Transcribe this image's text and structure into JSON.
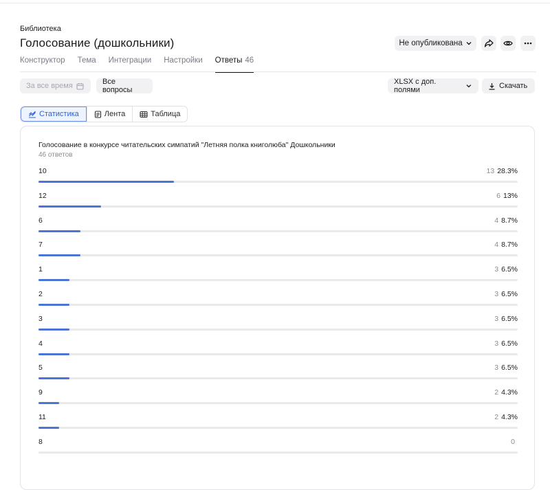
{
  "header": {
    "breadcrumb": "Библиотека",
    "title": "Голосование (дошкольники)",
    "status_label": "Не опубликована"
  },
  "tabs": [
    {
      "label": "Конструктор",
      "count": ""
    },
    {
      "label": "Тема",
      "count": ""
    },
    {
      "label": "Интеграции",
      "count": ""
    },
    {
      "label": "Настройки",
      "count": ""
    },
    {
      "label": "Ответы",
      "count": "46",
      "active": true
    }
  ],
  "filters": {
    "period_placeholder": "За все время",
    "questions_label": "Все вопросы",
    "export_label": "XLSX с доп. полями",
    "download_label": "Скачать"
  },
  "views": {
    "stats": "Статистика",
    "feed": "Лента",
    "table": "Таблица"
  },
  "question": {
    "title": "Голосование в конкурсе читательских симпатий \"Летняя полка книголюба\" Дошкольники",
    "responses": "46 ответов"
  },
  "chart_data": {
    "type": "bar",
    "categories": [
      "10",
      "12",
      "6",
      "7",
      "1",
      "2",
      "3",
      "4",
      "5",
      "9",
      "11",
      "8"
    ],
    "counts": [
      13,
      6,
      4,
      4,
      3,
      3,
      3,
      3,
      3,
      2,
      2,
      0
    ],
    "percents": [
      "28.3%",
      "13%",
      "8.7%",
      "8.7%",
      "6.5%",
      "6.5%",
      "6.5%",
      "6.5%",
      "6.5%",
      "4.3%",
      "4.3%",
      ""
    ],
    "values": [
      28.3,
      13,
      8.7,
      8.7,
      6.5,
      6.5,
      6.5,
      6.5,
      6.5,
      4.3,
      4.3,
      0
    ]
  },
  "colors": {
    "accent": "#4a74d6",
    "track": "#e9e9ed"
  }
}
